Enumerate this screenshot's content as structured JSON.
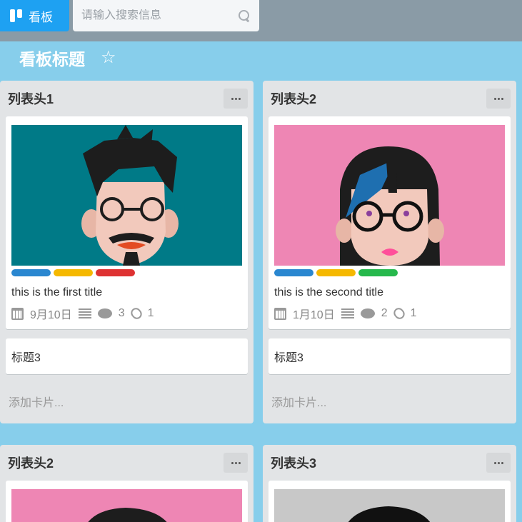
{
  "header": {
    "board_button_label": "看板",
    "search_placeholder": "请输入搜索信息"
  },
  "board": {
    "title": "看板标题"
  },
  "lists": [
    {
      "title": "列表头1",
      "cards": [
        {
          "title": "this is the first title",
          "label_colors": [
            "#2a87d0",
            "#f5b800",
            "#de3232"
          ],
          "due_date": "9月10日",
          "comment_count": "3",
          "attachment_count": "1",
          "image_bg": "#007a87"
        },
        {
          "title": "标题3"
        }
      ],
      "add_card_label": "添加卡片..."
    },
    {
      "title": "列表头2",
      "cards": [
        {
          "title": "this is the second title",
          "label_colors": [
            "#2a87d0",
            "#f5b800",
            "#26b84c"
          ],
          "due_date": "1月10日",
          "comment_count": "2",
          "attachment_count": "1",
          "image_bg": "#ee86b4"
        },
        {
          "title": "标题3"
        }
      ],
      "add_card_label": "添加卡片..."
    },
    {
      "title": "列表头2"
    },
    {
      "title": "列表头3"
    }
  ],
  "icons": {
    "star": "star-icon",
    "more": "more-icon",
    "calendar": "calendar-icon",
    "description": "description-icon",
    "comment": "comment-icon",
    "attachment": "paperclip-icon",
    "search": "search-icon"
  }
}
